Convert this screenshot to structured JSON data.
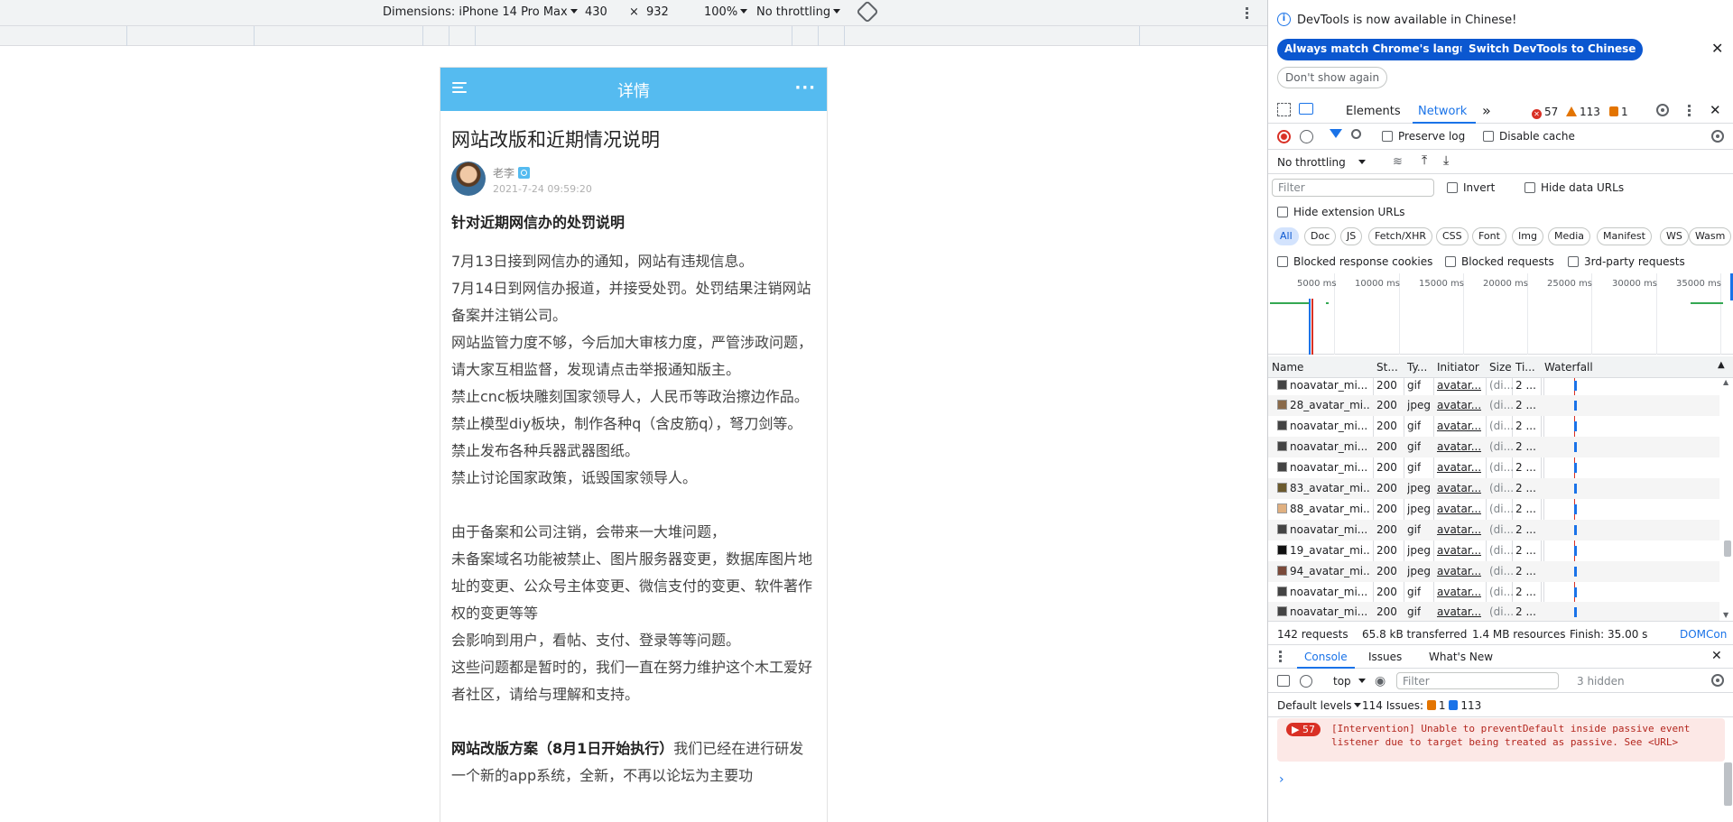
{
  "device_toolbar": {
    "dimensions": "Dimensions: iPhone 14 Pro Max",
    "width": "430",
    "times": "×",
    "height": "932",
    "zoom": "100%",
    "throttling": "No throttling"
  },
  "mobile": {
    "header_title": "详情",
    "more": "···",
    "article_title": "网站改版和近期情况说明",
    "author": "老李",
    "time": "2021-7-24 09:59:20",
    "heading1": "针对近期网信办的处罚说明",
    "p1": [
      "7月13日接到网信办的通知，网站有违规信息。",
      "7月14日到网信办报道，并接受处罚。处罚结果注销网站备案并注销公司。",
      "网站监管力度不够，今后加大审核力度，严管涉政问题，请大家互相监督，发现请点击举报通知版主。",
      "禁止cnc板块雕刻国家领导人，人民币等政治擦边作品。",
      "禁止模型diy板块，制作各种q（含皮筋q），弩刀剑等。禁止发布各种兵器武器图纸。",
      "禁止讨论国家政策，诋毁国家领导人。"
    ],
    "p2": [
      "由于备案和公司注销，会带来一大堆问题，",
      "未备案域名功能被禁止、图片服务器变更，数据库图片地址的变更、公众号主体变更、微信支付的变更、软件著作权的变更等等",
      "会影响到用户，看帖、支付、登录等等问题。",
      "这些问题都是暂时的，我们一直在努力维护这个木工爱好者社区，请给与理解和支持。"
    ],
    "heading2": "网站改版方案（8月1日开始执行）",
    "p3": "我们已经在进行研发一个新的app系统，全新，不再以论坛为主要功"
  },
  "devtools": {
    "info": {
      "message": "DevTools is now available in Chinese!",
      "btn_match": "Always match Chrome's language",
      "btn_switch": "Switch DevTools to Chinese",
      "btn_dont_show": "Don't show again"
    },
    "tabs": {
      "elements": "Elements",
      "network": "Network",
      "more": "»",
      "errors": "57",
      "warnings": "113",
      "issues": "1"
    },
    "network_toolbar": {
      "preserve_log": "Preserve log",
      "disable_cache": "Disable cache",
      "throttling": "No throttling"
    },
    "filter": {
      "placeholder": "Filter",
      "invert": "Invert",
      "hide_data_urls": "Hide data URLs",
      "hide_extension_urls": "Hide extension URLs"
    },
    "types": [
      "All",
      "Doc",
      "JS",
      "Fetch/XHR",
      "CSS",
      "Font",
      "Img",
      "Media",
      "Manifest",
      "WS",
      "Wasm"
    ],
    "blocked": {
      "cookies": "Blocked response cookies",
      "requests": "Blocked requests",
      "third_party": "3rd-party requests"
    },
    "overview_labels": [
      "5000 ms",
      "10000 ms",
      "15000 ms",
      "20000 ms",
      "25000 ms",
      "30000 ms",
      "35000 ms"
    ],
    "columns": {
      "name": "Name",
      "status": "St...",
      "type": "Ty...",
      "initiator": "Initiator",
      "size": "Size",
      "time": "Ti...",
      "waterfall": "Waterfall"
    },
    "rows": [
      {
        "name": "noavatar_mi...",
        "status": "200",
        "type": "gif",
        "initiator": "avatar...",
        "size": "(di...",
        "time": "2 ..."
      },
      {
        "name": "28_avatar_mi...",
        "status": "200",
        "type": "jpeg",
        "initiator": "avatar...",
        "size": "(di...",
        "time": "2 ..."
      },
      {
        "name": "noavatar_mi...",
        "status": "200",
        "type": "gif",
        "initiator": "avatar...",
        "size": "(di...",
        "time": "2 ..."
      },
      {
        "name": "noavatar_mi...",
        "status": "200",
        "type": "gif",
        "initiator": "avatar...",
        "size": "(di...",
        "time": "2 ..."
      },
      {
        "name": "noavatar_mi...",
        "status": "200",
        "type": "gif",
        "initiator": "avatar...",
        "size": "(di...",
        "time": "2 ..."
      },
      {
        "name": "83_avatar_mi...",
        "status": "200",
        "type": "jpeg",
        "initiator": "avatar...",
        "size": "(di...",
        "time": "2 ..."
      },
      {
        "name": "88_avatar_mi...",
        "status": "200",
        "type": "jpeg",
        "initiator": "avatar...",
        "size": "(di...",
        "time": "2 ..."
      },
      {
        "name": "noavatar_mi...",
        "status": "200",
        "type": "gif",
        "initiator": "avatar...",
        "size": "(di...",
        "time": "2 ..."
      },
      {
        "name": "19_avatar_mi...",
        "status": "200",
        "type": "jpeg",
        "initiator": "avatar...",
        "size": "(di...",
        "time": "2 ..."
      },
      {
        "name": "94_avatar_mi...",
        "status": "200",
        "type": "jpeg",
        "initiator": "avatar...",
        "size": "(di...",
        "time": "2 ..."
      },
      {
        "name": "noavatar_mi...",
        "status": "200",
        "type": "gif",
        "initiator": "avatar...",
        "size": "(di...",
        "time": "2 ..."
      },
      {
        "name": "noavatar_mi...",
        "status": "200",
        "type": "gif",
        "initiator": "avatar...",
        "size": "(di...",
        "time": "2 ..."
      }
    ],
    "summary": {
      "requests": "142 requests",
      "transferred": "65.8 kB transferred",
      "resources": "1.4 MB resources",
      "finish": "Finish: 35.00 s",
      "domcon": "DOMCon"
    },
    "drawer": {
      "console_tab": "Console",
      "issues_tab": "Issues",
      "whats_new_tab": "What's New",
      "context": "top",
      "filter_placeholder": "Filter",
      "hidden": "3 hidden",
      "default_levels": "Default levels",
      "issues_label": "114 Issues:",
      "issues_warn": "1",
      "issues_info": "113",
      "msg_count": "57",
      "message": "[Intervention] Unable to preventDefault inside passive event listener due to target being treated as passive. See <URL>",
      "prompt": "›"
    }
  },
  "colors": {
    "header_blue": "#55bbf0",
    "devtools_blue": "#1a73e8",
    "error_red": "#d93025"
  }
}
